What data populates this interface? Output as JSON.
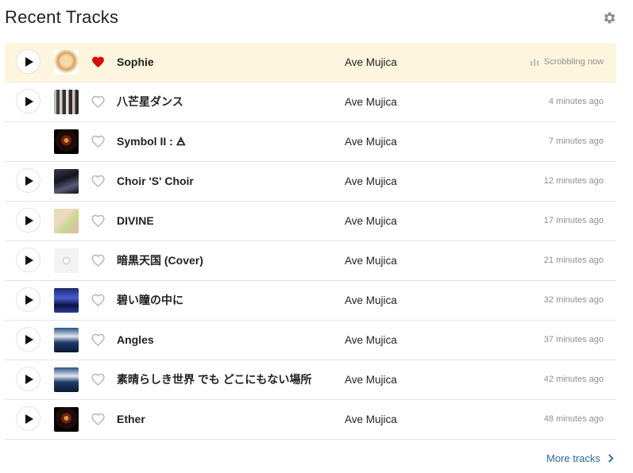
{
  "header": {
    "title": "Recent Tracks",
    "settings_icon": "gear-icon"
  },
  "colors": {
    "active_row_bg": "#fdf5dd",
    "loved_heart": "#d51007",
    "link": "#2d6a9a",
    "timestamp": "#8f8f8f"
  },
  "tracks": [
    {
      "name": "Sophie",
      "artist": "Ave Mujica",
      "time": "Scrobbling now",
      "loved": true,
      "playable": true,
      "now_playing": true
    },
    {
      "name": "八芒星ダンス",
      "artist": "Ave Mujica",
      "time": "4 minutes ago",
      "loved": false,
      "playable": true
    },
    {
      "name": "Symbol II : 🜁",
      "artist": "Ave Mujica",
      "time": "7 minutes ago",
      "loved": false,
      "playable": false
    },
    {
      "name": "Choir 'S' Choir",
      "artist": "Ave Mujica",
      "time": "12 minutes ago",
      "loved": false,
      "playable": true
    },
    {
      "name": "DIVINE",
      "artist": "Ave Mujica",
      "time": "17 minutes ago",
      "loved": false,
      "playable": true
    },
    {
      "name": "暗黒天国 (Cover)",
      "artist": "Ave Mujica",
      "time": "21 minutes ago",
      "loved": false,
      "playable": true
    },
    {
      "name": "碧い瞳の中に",
      "artist": "Ave Mujica",
      "time": "32 minutes ago",
      "loved": false,
      "playable": true
    },
    {
      "name": "Angles",
      "artist": "Ave Mujica",
      "time": "37 minutes ago",
      "loved": false,
      "playable": true
    },
    {
      "name": "素晴らしき世界 でも どこにもない場所",
      "artist": "Ave Mujica",
      "time": "42 minutes ago",
      "loved": false,
      "playable": true
    },
    {
      "name": "Ether",
      "artist": "Ave Mujica",
      "time": "48 minutes ago",
      "loved": false,
      "playable": true
    }
  ],
  "footer": {
    "more_label": "More tracks"
  }
}
